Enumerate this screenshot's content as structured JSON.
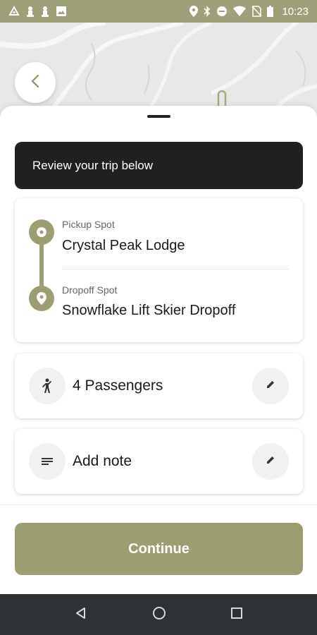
{
  "status_bar": {
    "time": "10:23",
    "left_icons": [
      "android-logo-icon",
      "chess-piece-icon",
      "chess-piece-icon",
      "image-icon"
    ],
    "right_icons": [
      "location-icon",
      "bluetooth-icon",
      "do-not-disturb-icon",
      "wifi-icon",
      "no-sim-icon",
      "battery-icon"
    ]
  },
  "header": {
    "back_icon": "chevron-left-icon"
  },
  "banner": {
    "text": "Review your trip below"
  },
  "trip": {
    "pickup_label": "Pickup Spot",
    "pickup_name": "Crystal Peak Lodge",
    "dropoff_label": "Dropoff Spot",
    "dropoff_name": "Snowflake Lift Skier Dropoff"
  },
  "passengers": {
    "label": "4 Passengers",
    "icon": "person-icon",
    "edit_icon": "pencil-icon"
  },
  "note": {
    "label": "Add note",
    "icon": "notes-icon",
    "edit_icon": "pencil-icon"
  },
  "continue_button": {
    "label": "Continue"
  },
  "colors": {
    "accent": "#9c9e72",
    "status_bar": "#9ea079",
    "banner_bg": "#1f2021",
    "nav_bar": "#2e3135"
  },
  "nav_bar": {
    "buttons": [
      "back-triangle-icon",
      "home-circle-icon",
      "recents-square-icon"
    ]
  }
}
